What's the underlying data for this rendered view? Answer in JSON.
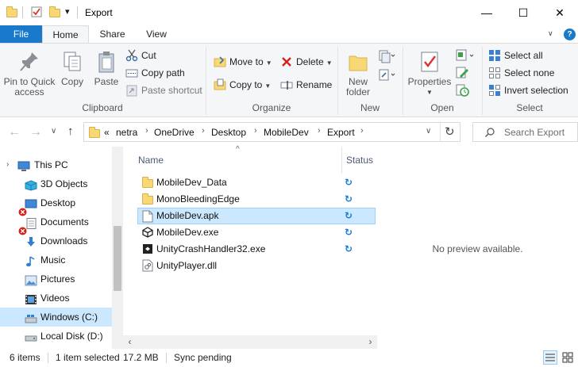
{
  "window": {
    "title": "Export",
    "minimize_glyph": "—",
    "maximize_glyph": "☐",
    "close_glyph": "✕"
  },
  "qat": {
    "dropdown_glyph": "▾"
  },
  "tabs": {
    "file": "File",
    "home": "Home",
    "share": "Share",
    "view": "View",
    "expand_glyph": "∨",
    "help_glyph": "?"
  },
  "ribbon": {
    "clipboard": {
      "group_label": "Clipboard",
      "pin_label_1": "Pin to Quick",
      "pin_label_2": "access",
      "copy": "Copy",
      "paste": "Paste",
      "cut": "Cut",
      "copy_path": "Copy path",
      "paste_shortcut": "Paste shortcut"
    },
    "organize": {
      "group_label": "Organize",
      "move_to": "Move to",
      "copy_to": "Copy to",
      "delete": "Delete",
      "rename": "Rename"
    },
    "new": {
      "group_label": "New",
      "new_folder_1": "New",
      "new_folder_2": "folder"
    },
    "open": {
      "group_label": "Open",
      "properties": "Properties"
    },
    "select": {
      "group_label": "Select",
      "select_all": "Select all",
      "select_none": "Select none",
      "invert_selection": "Invert selection"
    }
  },
  "address": {
    "back_glyph": "←",
    "forward_glyph": "→",
    "dropdown_glyph": "∨",
    "up_glyph": "↑",
    "overflow_glyph": "«",
    "crumbs": [
      "netra",
      "OneDrive",
      "Desktop",
      "MobileDev",
      "Export"
    ],
    "crumb_sep": "›",
    "refresh_glyph": "↻",
    "search_placeholder": "Search Export"
  },
  "nav": {
    "items": [
      {
        "label": "This PC"
      },
      {
        "label": "3D Objects"
      },
      {
        "label": "Desktop"
      },
      {
        "label": "Documents"
      },
      {
        "label": "Downloads"
      },
      {
        "label": "Music"
      },
      {
        "label": "Pictures"
      },
      {
        "label": "Videos"
      },
      {
        "label": "Windows (C:)"
      },
      {
        "label": "Local Disk (D:)"
      }
    ],
    "expand_glyph": "›"
  },
  "files": {
    "columns": {
      "name": "Name",
      "status": "Status",
      "sort_glyph": "^"
    },
    "rows": [
      {
        "name": "MobileDev_Data",
        "type": "folder"
      },
      {
        "name": "MonoBleedingEdge",
        "type": "folder"
      },
      {
        "name": "MobileDev.apk",
        "type": "file"
      },
      {
        "name": "MobileDev.exe",
        "type": "unity"
      },
      {
        "name": "UnityCrashHandler32.exe",
        "type": "exe"
      },
      {
        "name": "UnityPlayer.dll",
        "type": "dll"
      }
    ],
    "sync_glyph": "↻"
  },
  "hscroll": {
    "left_glyph": "‹",
    "right_glyph": "›"
  },
  "preview": {
    "text": "No preview available."
  },
  "status": {
    "item_count": "6 items",
    "selection": "1 item selected",
    "size": "17.2 MB",
    "sync": "Sync pending"
  },
  "colors": {
    "accent": "#1979ca",
    "selection": "#cce8ff",
    "sync_icon": "#1a7ad9",
    "folder": "#f8d775"
  }
}
